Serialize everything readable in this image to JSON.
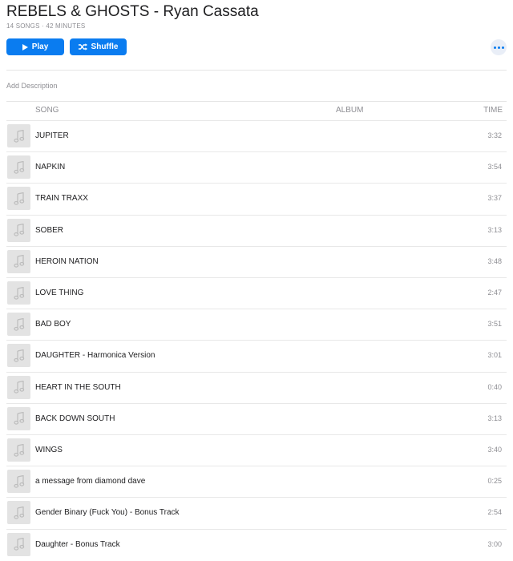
{
  "album": {
    "title": "REBELS & GHOSTS - Ryan Cassata",
    "meta": "14 SONGS · 42 MINUTES"
  },
  "actions": {
    "play_label": "Play",
    "shuffle_label": "Shuffle",
    "more_icon": "ellipsis-icon",
    "accent_color": "#0a7cf0"
  },
  "description_placeholder": "Add Description",
  "columns": {
    "song": "SONG",
    "album": "ALBUM",
    "time": "TIME"
  },
  "tracks": [
    {
      "name": "JUPITER",
      "album": "",
      "time": "3:32"
    },
    {
      "name": "NAPKIN",
      "album": "",
      "time": "3:54"
    },
    {
      "name": "TRAIN TRAXX",
      "album": "",
      "time": "3:37"
    },
    {
      "name": "SOBER",
      "album": "",
      "time": "3:13"
    },
    {
      "name": "HEROIN NATION",
      "album": "",
      "time": "3:48"
    },
    {
      "name": "LOVE THING",
      "album": "",
      "time": "2:47"
    },
    {
      "name": "BAD BOY",
      "album": "",
      "time": "3:51"
    },
    {
      "name": "DAUGHTER - Harmonica Version",
      "album": "",
      "time": "3:01"
    },
    {
      "name": "HEART IN THE SOUTH",
      "album": "",
      "time": "0:40"
    },
    {
      "name": "BACK DOWN SOUTH",
      "album": "",
      "time": "3:13"
    },
    {
      "name": "WINGS",
      "album": "",
      "time": "3:40"
    },
    {
      "name": "a message from diamond dave",
      "album": "",
      "time": "0:25"
    },
    {
      "name": "Gender Binary (Fuck You) - Bonus Track",
      "album": "",
      "time": "2:54"
    },
    {
      "name": "Daughter - Bonus Track",
      "album": "",
      "time": "3:00"
    }
  ]
}
